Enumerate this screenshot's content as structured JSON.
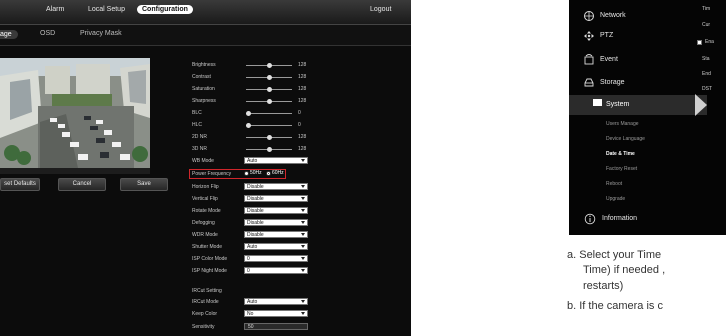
{
  "camera_ui": {
    "topnav": {
      "alarm": "Alarm",
      "local_setup": "Local Setup",
      "configuration": "Configuration",
      "logout": "Logout"
    },
    "subnav": {
      "image": "age",
      "osd": "OSD",
      "privacy_mask": "Privacy Mask"
    },
    "buttons": {
      "reset_defaults": "set Defaults",
      "cancel": "Cancel",
      "save": "Save"
    },
    "sliders": [
      {
        "label": "Brightness",
        "value": "128",
        "fraction": 0.5
      },
      {
        "label": "Contrast",
        "value": "128",
        "fraction": 0.5
      },
      {
        "label": "Saturation",
        "value": "128",
        "fraction": 0.5
      },
      {
        "label": "Sharpness",
        "value": "128",
        "fraction": 0.5
      },
      {
        "label": "BLC",
        "value": "0",
        "fraction": 0.0
      },
      {
        "label": "HLC",
        "value": "0",
        "fraction": 0.0
      },
      {
        "label": "2D NR",
        "value": "128",
        "fraction": 0.5
      },
      {
        "label": "3D NR",
        "value": "128",
        "fraction": 0.5
      }
    ],
    "wb_mode": {
      "label": "WB Mode",
      "value": "Auto"
    },
    "power_frequency": {
      "label": "Power Frequency",
      "option_50": "50Hz",
      "option_60": "60Hz",
      "selected": "60Hz"
    },
    "selects": [
      {
        "label": "Horizon Flip",
        "value": "Disable"
      },
      {
        "label": "Vertical Flip",
        "value": "Disable"
      },
      {
        "label": "Rotate Mode",
        "value": "Disable"
      },
      {
        "label": "Defogging",
        "value": "Disable"
      },
      {
        "label": "WDR Mode",
        "value": "Disable"
      },
      {
        "label": "Shutter Mode",
        "value": "Auto"
      },
      {
        "label": "ISP Color Mode",
        "value": "0"
      },
      {
        "label": "ISP Night Mode",
        "value": "0"
      }
    ],
    "ircut": {
      "title": "IRCut Setting",
      "mode": {
        "label": "IRCut Mode",
        "value": "Auto"
      },
      "keep_color": {
        "label": "Keep Color",
        "value": "No"
      },
      "sensitivity": {
        "label": "Sensitivity",
        "value": "50"
      }
    }
  },
  "manual": {
    "menu": {
      "network": "Network",
      "ptz": "PTZ",
      "event": "Event",
      "storage": "Storage",
      "system": "System",
      "information": "Information",
      "sub_items": [
        "Users Manage",
        "Device Language",
        "Date & Time",
        "Factory Reset",
        "Reboot",
        "Upgrade"
      ]
    },
    "right_col": [
      "Tim",
      "Cur",
      "Ena",
      "Sta",
      "End",
      "DST"
    ],
    "text": {
      "a_line1": "a.  Select your Time",
      "a_line2": "Time) if needed ,",
      "a_line3": "restarts)",
      "b_line1": "b.  If the camera is c"
    }
  },
  "colors": {
    "highlight_box": "#d0262b",
    "menu_bg": "#050505"
  }
}
